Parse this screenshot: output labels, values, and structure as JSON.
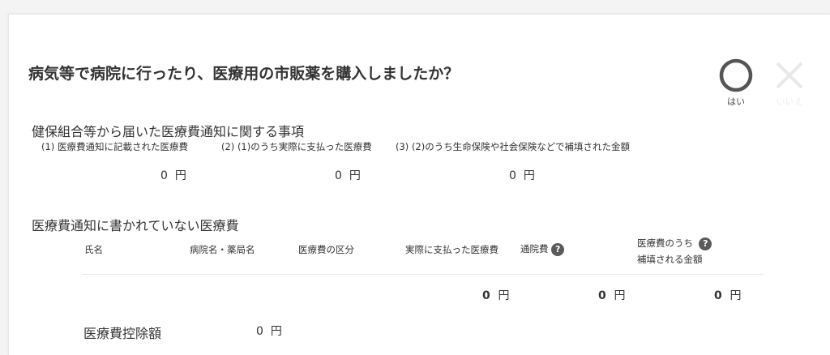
{
  "question": {
    "text": "病気等で病院に行ったり、医療用の市販薬を購入しましたか？",
    "yes_label": "はい",
    "no_label": "いいえ"
  },
  "insurer_notice": {
    "title": "健保組合等から届いた医療費通知に関する事項",
    "columns": [
      {
        "label": "(1) 医療費通知に記載された医療費",
        "value": "0",
        "unit": "円"
      },
      {
        "label": "(2) (1)のうち実際に支払った医療費",
        "value": "0",
        "unit": "円"
      },
      {
        "label": "(3) (2)のうち生命保険や社会保険などで補填された金額",
        "value": "0",
        "unit": "円"
      }
    ]
  },
  "other_expenses": {
    "title": "医療費通知に書かれていない医療費",
    "headers": {
      "name": "氏名",
      "hospital": "病院名・薬局名",
      "category": "医療費の区分",
      "paid": "実際に支払った医療費",
      "transport": "通院費",
      "covered_line1": "医療費のうち",
      "covered_line2": "補填される金額"
    },
    "totals": [
      {
        "value": "0",
        "unit": "円"
      },
      {
        "value": "0",
        "unit": "円"
      },
      {
        "value": "0",
        "unit": "円"
      }
    ]
  },
  "deduction": {
    "label": "医療費控除額",
    "value": "0",
    "unit": "円"
  },
  "icons": {
    "yes": "circle-icon",
    "no": "cross-icon",
    "help": "question-mark-icon"
  },
  "help_glyph": "?"
}
